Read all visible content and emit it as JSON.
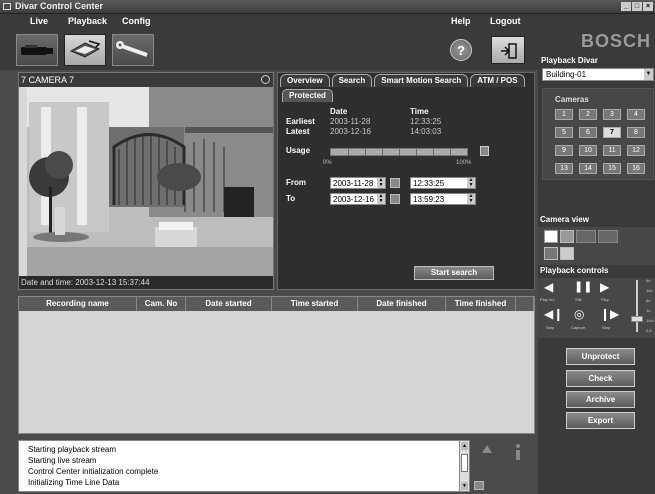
{
  "window": {
    "title": "Divar Control Center"
  },
  "menu": {
    "live": "Live",
    "playback": "Playback",
    "config": "Config",
    "help": "Help",
    "logout": "Logout"
  },
  "brand": "BOSCH",
  "camera": {
    "title": "7 CAMERA 7",
    "footer": "Date and time: 2003-12-13 15:37:44"
  },
  "search": {
    "tabs": [
      "Overview",
      "Search",
      "Smart Motion Search",
      "ATM / POS"
    ],
    "subtab": "Protected",
    "date_header": "Date",
    "time_header": "Time",
    "earliest_label": "Earliest",
    "earliest_date": "2003-11-28",
    "earliest_time": "12:33:25",
    "latest_label": "Latest",
    "latest_date": "2003-12-16",
    "latest_time": "14:03:03",
    "usage_label": "Usage",
    "usage_min": "0%",
    "usage_max": "100%",
    "from_label": "From",
    "from_date": "2003-11-28",
    "from_time": "12:33:25",
    "to_label": "To",
    "to_date": "2003-12-16",
    "to_time": "13:59:23",
    "start_button": "Start search"
  },
  "results": {
    "columns": [
      "Recording name",
      "Cam. No",
      "Date started",
      "Time started",
      "Date finished",
      "Time finished"
    ]
  },
  "log": {
    "lines": [
      "Starting playback stream",
      "Starting live stream",
      "Control Center initialization complete",
      "Initializing Time Line Data"
    ]
  },
  "right": {
    "playback_title": "Playback Divar",
    "divar_select": "Building-01",
    "cameras_title": "Cameras",
    "camera_numbers": [
      "1",
      "2",
      "3",
      "4",
      "5",
      "6",
      "7",
      "8",
      "9",
      "10",
      "11",
      "12",
      "13",
      "14",
      "15",
      "16"
    ],
    "selected_camera": "7",
    "camera_view_title": "Camera view",
    "playback_controls_title": "Playback controls",
    "pb_labels": [
      "Play rev",
      "Still",
      "Play",
      "Step",
      "Capture",
      "Step"
    ],
    "speed_labels": [
      "4x",
      "16x",
      "8x",
      "1x",
      "1/4x",
      "0.5"
    ],
    "unprotect": "Unprotect",
    "check": "Check",
    "archive": "Archive",
    "export": "Export"
  }
}
